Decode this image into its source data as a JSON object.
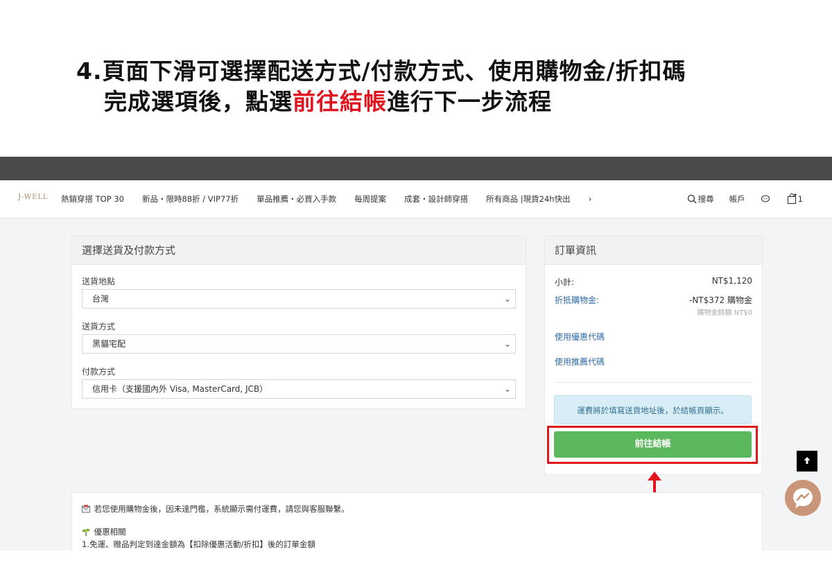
{
  "instruction": {
    "line1": "4.頁面下滑可選擇配送方式/付款方式、使用購物金/折扣碼",
    "line2_prefix": "完成選項後，點選",
    "line2_highlight": "前往結帳",
    "line2_suffix": "進行下一步流程"
  },
  "navbar": {
    "logo": "J-WELL",
    "items": [
      "熱銷穿搭 TOP 30",
      "新品・限時88折 / VIP77折",
      "單品推薦・必買入手款",
      "每周提案",
      "成套・設計師穿搭",
      "所有商品 |現貨24h快出"
    ],
    "more": "›",
    "search": "搜尋",
    "account": "帳戶",
    "cart_count": "1"
  },
  "shipping_panel": {
    "title": "選擇送貨及付款方式",
    "location_label": "送貨地點",
    "location_value": "台灣",
    "method_label": "送貨方式",
    "method_value": "黑貓宅配",
    "payment_label": "付款方式",
    "payment_value": "信用卡（支援國內外 Visa, MasterCard, JCB）"
  },
  "order_panel": {
    "title": "訂單資訊",
    "subtotal_label": "小計:",
    "subtotal_value": "NT$1,120",
    "credit_label": "折抵購物金:",
    "credit_value": "-NT$372 購物金",
    "credit_balance": "購物金餘額 NT$0",
    "coupon_link": "使用優惠代碼",
    "referral_link": "使用推薦代碼",
    "shipping_notice": "運費將於填寫送貨地址後，於結帳頁顯示。",
    "checkout_button": "前往結帳"
  },
  "bottom_info": {
    "notice": "若您使用購物金後，因未達門檻，系統顯示需付運費，請您與客服聯繫。",
    "promo_heading": "優惠相關",
    "promo_line1": "1.免運、贈品判定到達金額為【扣除優惠活動/折扣】後的訂單金額"
  },
  "colors": {
    "highlight": "#e0141e",
    "checkout_green": "#5cb85c",
    "link_blue": "#2f6aa8",
    "notice_bg": "#d9edf7"
  }
}
